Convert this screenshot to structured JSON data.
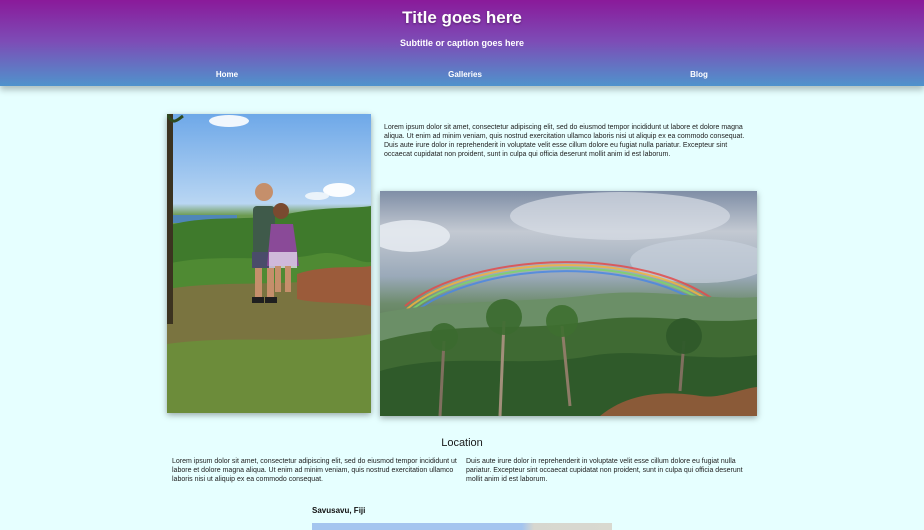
{
  "header": {
    "title": "Title goes here",
    "subtitle": "Subtitle or caption goes here"
  },
  "nav": {
    "items": [
      {
        "label": "Home"
      },
      {
        "label": "Galleries"
      },
      {
        "label": "Blog"
      }
    ]
  },
  "intro": {
    "text": "Lorem ipsum dolor sit amet, consectetur adipiscing elit, sed do eiusmod tempor incididunt ut labore et dolore magna aliqua. Ut enim ad minim veniam, quis nostrud exercitation ullamco laboris nisi ut aliquip ex ea commodo consequat. Duis aute irure dolor in reprehenderit in voluptate velit esse cillum dolore eu fugiat nulla pariatur. Excepteur sint occaecat cupidatat non proident, sunt in culpa qui officia deserunt mollit anim id est laborum."
  },
  "location": {
    "heading": "Location",
    "col_left": "Lorem ipsum dolor sit amet, consectetur adipiscing elit, sed do eiusmod tempor incididunt ut labore et dolore magna aliqua. Ut enim ad minim veniam, quis nostrud exercitation ullamco laboris nisi ut aliquip ex ea commodo consequat.",
    "col_right": "Duis aute irure dolor in reprehenderit in voluptate velit esse cillum dolore eu fugiat nulla pariatur. Excepteur sint occaecat cupidatat non proident, sunt in culpa qui officia deserunt mollit anim id est laborum.",
    "map_label": "Savusavu, Fiji"
  }
}
